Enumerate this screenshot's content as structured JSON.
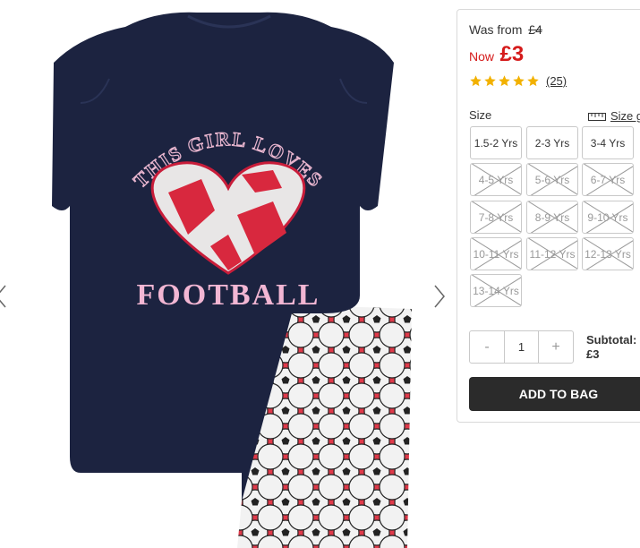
{
  "price": {
    "was_label": "Was from",
    "was_value": "£4",
    "now_label": "Now",
    "now_value": "£3"
  },
  "rating": {
    "stars": 5,
    "reviews": "(25)",
    "star_color": "#f2b100"
  },
  "size": {
    "label": "Size",
    "guide_label": "Size gu",
    "guide_icon": "ruler-icon",
    "options": [
      {
        "label": "1.5-2 Yrs",
        "available": true
      },
      {
        "label": "2-3 Yrs",
        "available": true
      },
      {
        "label": "3-4 Yrs",
        "available": true
      },
      {
        "label": "4-5 Yrs",
        "available": false
      },
      {
        "label": "5-6 Yrs",
        "available": false
      },
      {
        "label": "6-7 Yrs",
        "available": false
      },
      {
        "label": "7-8 Yrs",
        "available": false
      },
      {
        "label": "8-9 Yrs",
        "available": false
      },
      {
        "label": "9-10 Yrs",
        "available": false
      },
      {
        "label": "10-11 Yrs",
        "available": false
      },
      {
        "label": "11-12 Yrs",
        "available": false
      },
      {
        "label": "12-13 Yrs",
        "available": false
      },
      {
        "label": "13-14 Yrs",
        "available": false
      }
    ]
  },
  "quantity": {
    "minus": "-",
    "value": "1",
    "plus": "+"
  },
  "subtotal": {
    "label": "Subtotal:",
    "value": "£3"
  },
  "cta": {
    "add_to_bag": "ADD TO BAG"
  },
  "image": {
    "shirt_text_top": "THIS GIRL LOVES",
    "shirt_text_bottom": "FOOTBALL",
    "shirt_color": "#1c2340",
    "shorts_color": "#e03a4a"
  },
  "colors": {
    "price_red": "#d51b1b",
    "button_dark": "#2b2b2b"
  },
  "icons": {
    "prev": "chevron-left-icon",
    "next": "chevron-right-icon",
    "star": "star-icon"
  }
}
